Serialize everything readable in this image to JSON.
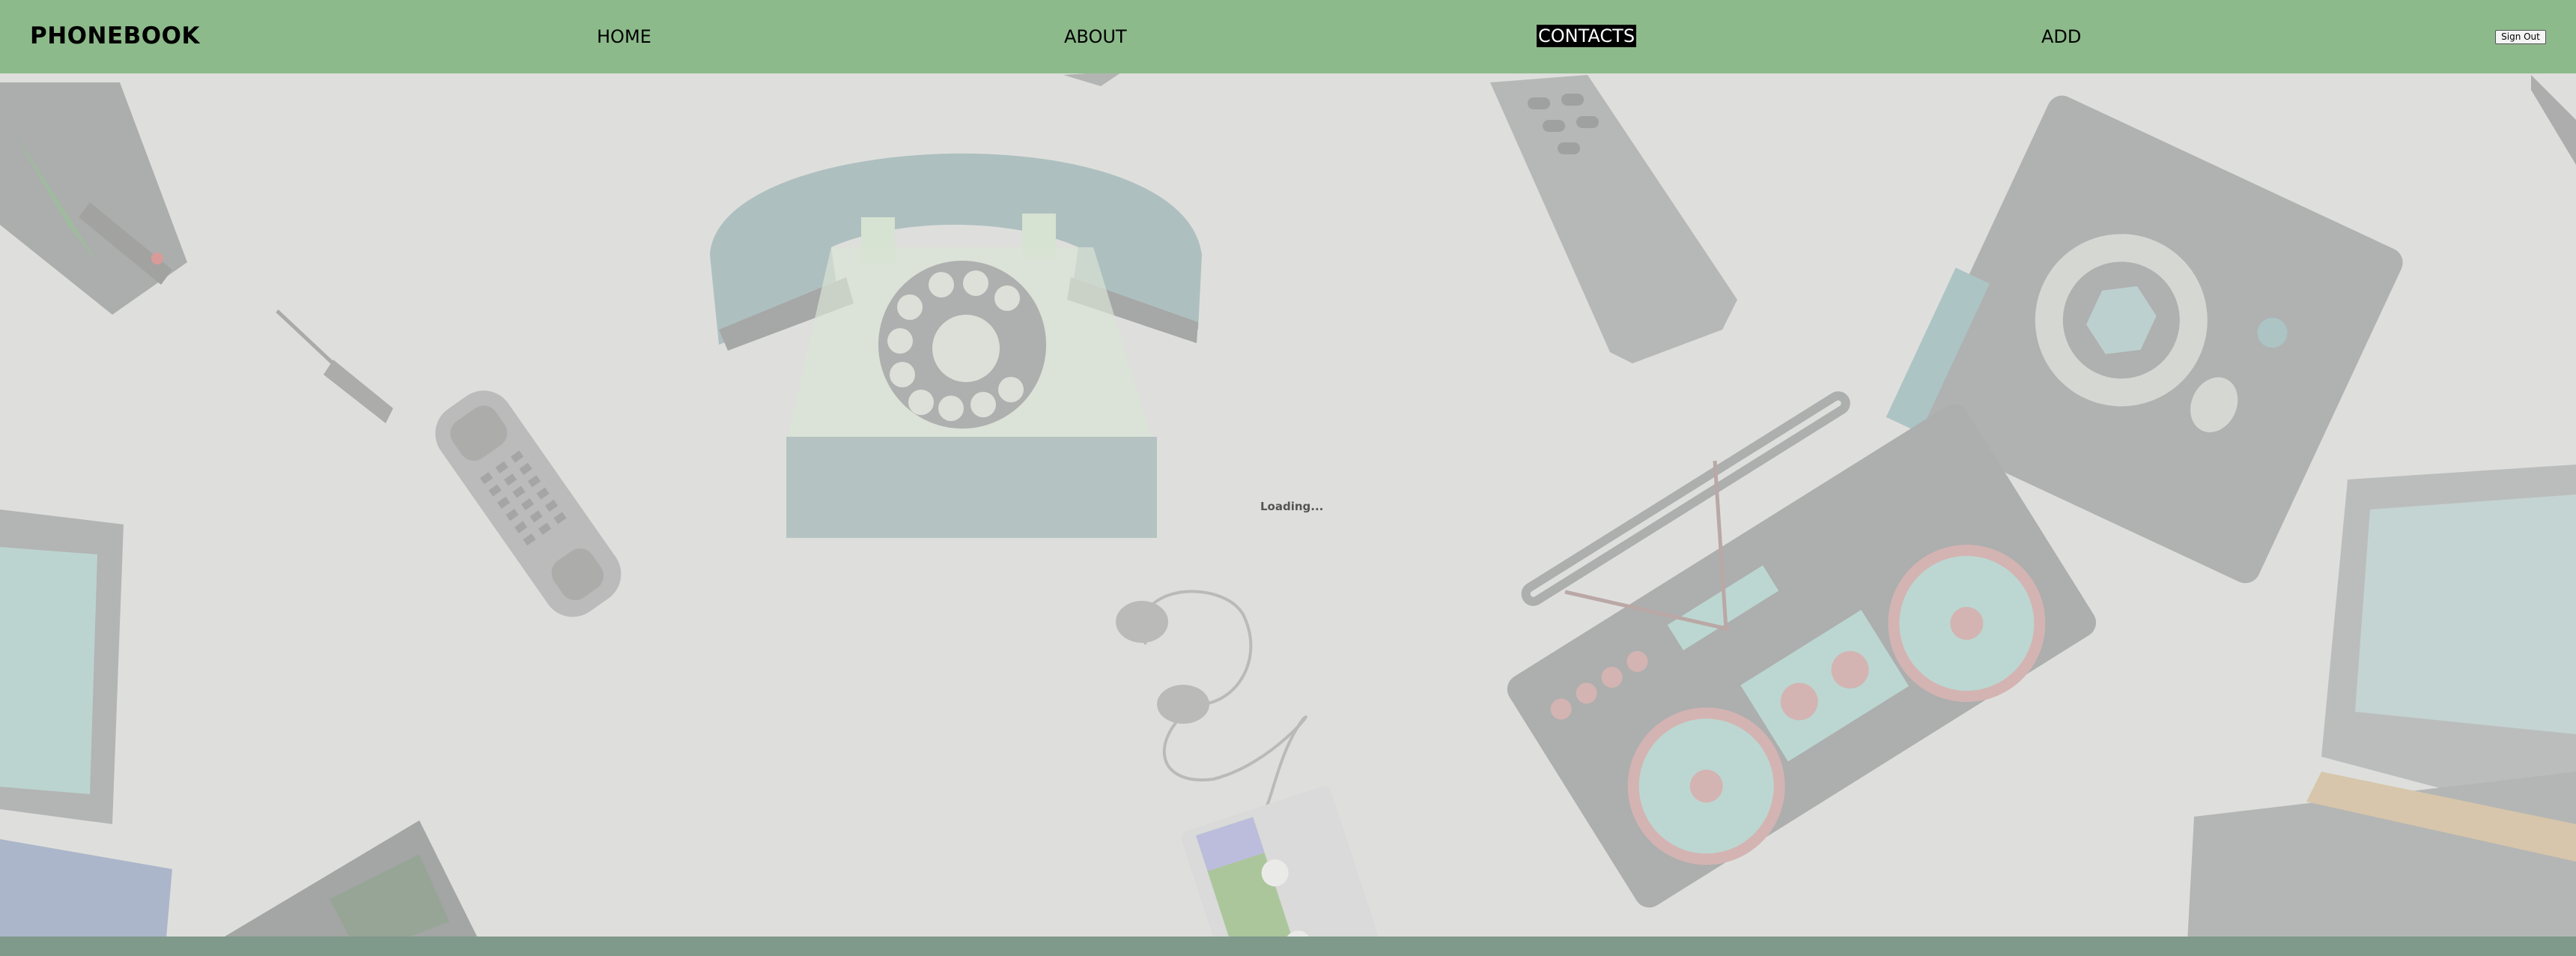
{
  "header": {
    "brand": "PHONEBOOK",
    "nav": {
      "home": "HOME",
      "about": "ABOUT",
      "contacts": "CONTACTS",
      "add": "ADD"
    },
    "active_nav": "CONTACTS",
    "sign_out_label": "Sign Out"
  },
  "main": {
    "status_text": "Loading..."
  },
  "background": {
    "items": [
      "rotary-phone",
      "brick-cell-phone",
      "tv-remote",
      "camera",
      "boombox",
      "headphones",
      "cassette-player",
      "screwdriver",
      "crt-monitor",
      "retro-console"
    ]
  },
  "colors": {
    "navbar": "#8dba8b",
    "active_nav_bg": "#000000",
    "active_nav_text": "#ffffff",
    "page_bg": "#d9dad7"
  }
}
